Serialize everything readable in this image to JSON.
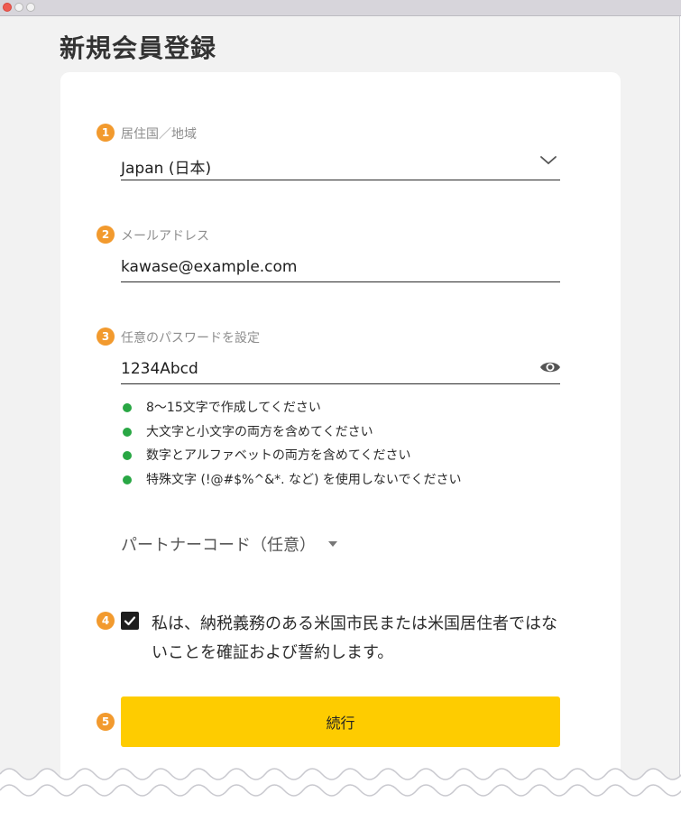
{
  "page": {
    "title": "新規会員登録"
  },
  "form": {
    "country": {
      "step": "1",
      "label": "居住国／地域",
      "value": "Japan (日本)"
    },
    "email": {
      "step": "2",
      "label": "メールアドレス",
      "value": "kawase@example.com"
    },
    "password": {
      "step": "3",
      "label": "任意のパスワードを設定",
      "value": "1234Abcd",
      "rules": [
        "8〜15文字で作成してください",
        "大文字と小文字の両方を含めてください",
        "数字とアルファベットの両方を含めてください",
        "特殊文字 (!@#$%^&*. など) を使用しないでください"
      ]
    },
    "partner_code": {
      "label": "パートナーコード（任意）"
    },
    "consent": {
      "step": "4",
      "checked": true,
      "text": "私は、納税義務のある米国市民または米国居住者ではないことを確証および誓約します。"
    },
    "submit": {
      "step": "5",
      "label": "続行"
    }
  },
  "colors": {
    "step_badge": "#f29a2e",
    "rule_ok": "#29a744",
    "primary_button": "#fecc00",
    "window_close": "#ee5b52"
  },
  "icons": {
    "country": "chevron-down-icon",
    "password": "eye-icon",
    "consent": "checkmark-icon",
    "partner": "caret-down-icon"
  }
}
